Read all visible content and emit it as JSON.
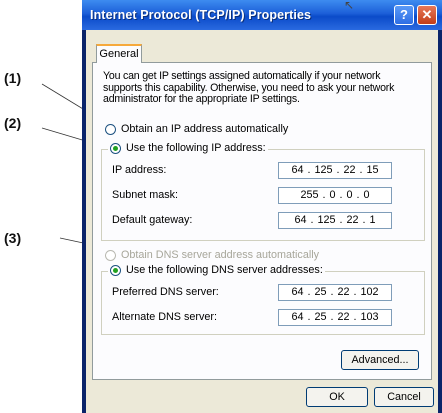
{
  "callouts": {
    "c1": "(1)",
    "c2": "(2)",
    "c3": "(3)"
  },
  "window": {
    "title": "Internet Protocol (TCP/IP) Properties",
    "help_glyph": "?",
    "close_glyph": "✕",
    "cursor_glyph": "↖"
  },
  "tab": {
    "general": "General"
  },
  "description": "You can get IP settings assigned automatically if your network supports this capability. Otherwise, you need to ask your network administrator for the appropriate IP settings.",
  "ip": {
    "auto_label": "Obtain an IP address automatically",
    "manual_label": "Use the following IP address:",
    "address_label": "IP address:",
    "address_value": "64 . 125 . 22 . 15",
    "subnet_label": "Subnet mask:",
    "subnet_value": "255 . 0 . 0 . 0",
    "gateway_label": "Default gateway:",
    "gateway_value": "64 . 125 . 22 . 1"
  },
  "dns": {
    "auto_label": "Obtain DNS server address automatically",
    "manual_label": "Use the following DNS server addresses:",
    "preferred_label": "Preferred DNS server:",
    "preferred_value": "64 . 25 . 22 . 102",
    "alternate_label": "Alternate DNS server:",
    "alternate_value": "64 . 25 . 22 . 103"
  },
  "buttons": {
    "advanced": "Advanced...",
    "ok": "OK",
    "cancel": "Cancel"
  },
  "colors": {
    "title_bar": "#1c5fd8",
    "dialog_bg": "#ece9d8",
    "radio_dot": "#21a121",
    "tab_accent": "#f6a93b"
  }
}
